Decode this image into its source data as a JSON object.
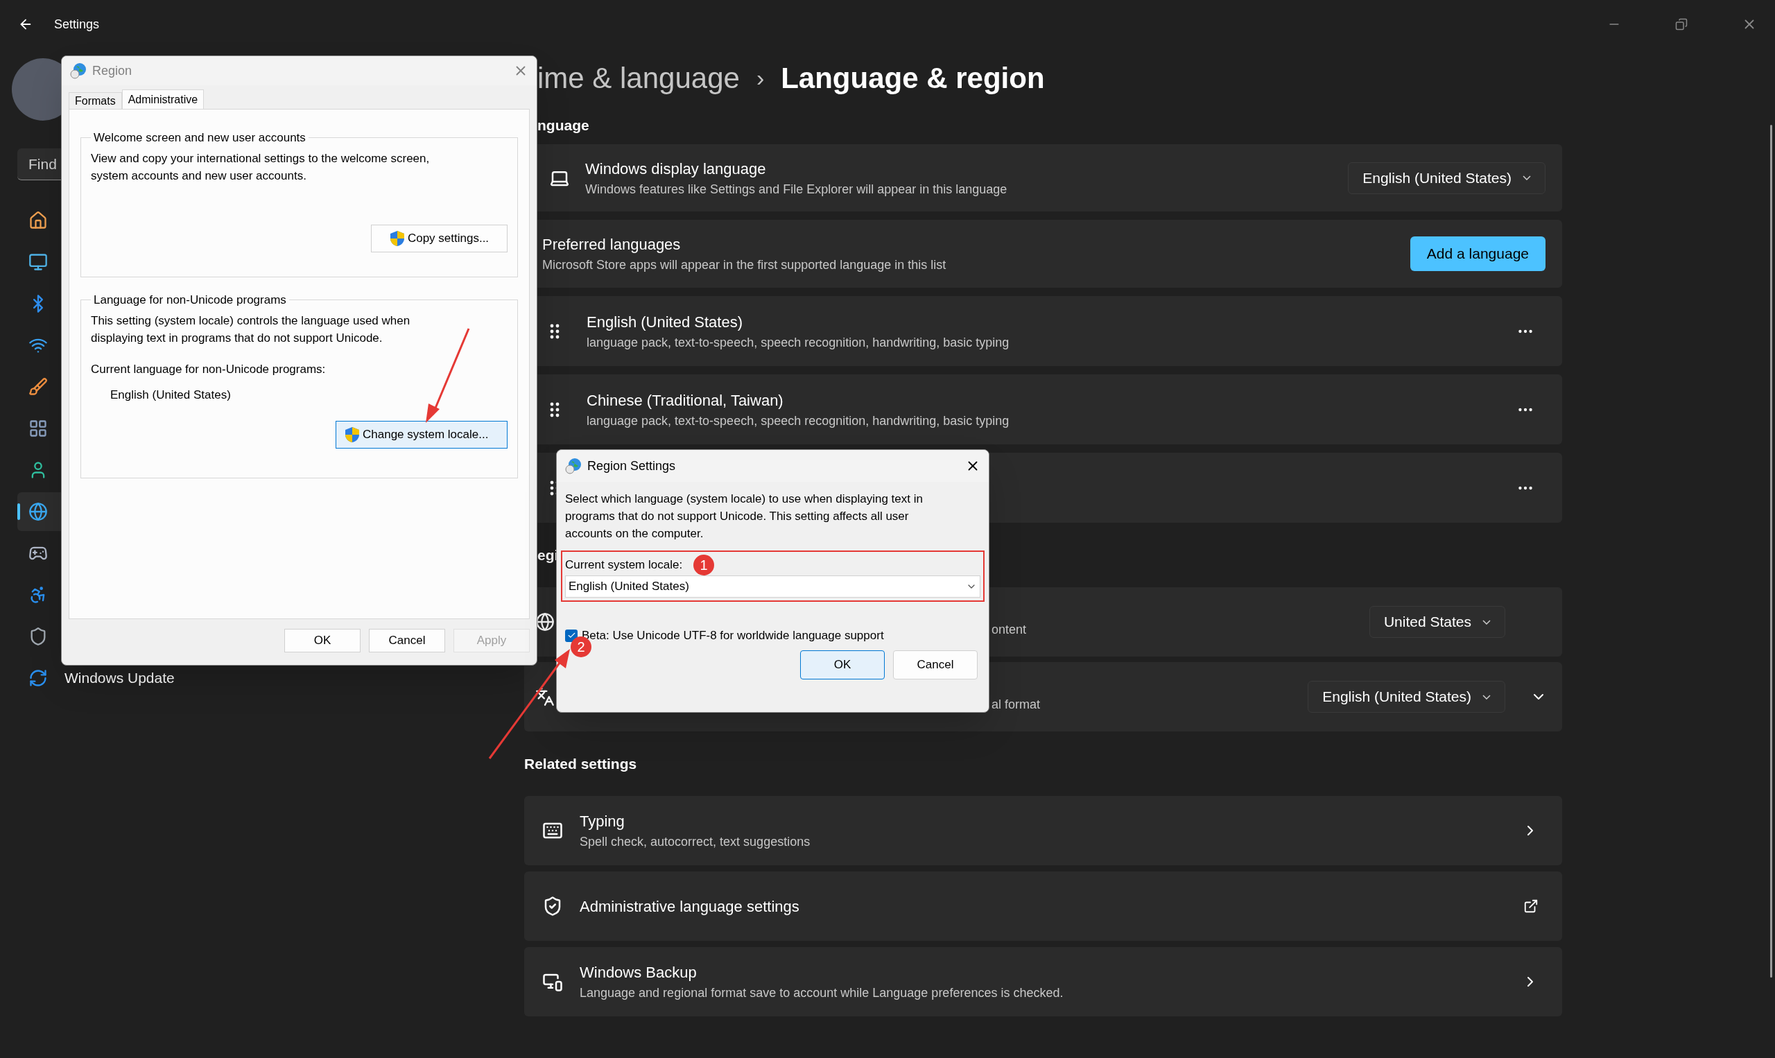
{
  "window": {
    "title": "Settings"
  },
  "sidebar": {
    "search": {
      "placeholder": "Find"
    },
    "nav_items": [
      {
        "selected": false
      },
      {
        "selected": false
      },
      {
        "selected": false
      },
      {
        "selected": false
      },
      {
        "selected": false
      },
      {
        "selected": false
      },
      {
        "selected": false
      },
      {
        "selected": true
      },
      {
        "selected": false
      },
      {
        "selected": false
      },
      {
        "selected": false
      },
      {
        "selected": false,
        "label": "Windows Update"
      }
    ]
  },
  "page": {
    "breadcrumb_parent": "ime & language",
    "separator": "›",
    "title": "Language & region"
  },
  "language_section": {
    "heading": "nguage",
    "display_language": {
      "title": "Windows display language",
      "description": "Windows features like Settings and File Explorer will appear in this language",
      "value": "English (United States)"
    },
    "preferred": {
      "title": "Preferred languages",
      "description": "Microsoft Store apps will appear in the first supported language in this list",
      "button": "Add a language"
    },
    "languages": [
      {
        "kind": "language",
        "name": "English (United States)",
        "features": "language pack, text-to-speech, speech recognition, handwriting, basic typing"
      },
      {
        "kind": "language",
        "name": "Chinese (Traditional, Taiwan)",
        "features": "language pack, text-to-speech, speech recognition, handwriting, basic typing"
      },
      {
        "kind": "covered"
      }
    ]
  },
  "region_section": {
    "heading": "egi",
    "rows": [
      {
        "text": "ontent",
        "value": "United States",
        "expandable": false
      },
      {
        "text": "al format",
        "value": "English (United States)",
        "expandable": true
      }
    ]
  },
  "related": {
    "heading": "Related settings",
    "items": [
      {
        "kind": "chevron",
        "title": "Typing",
        "description": "Spell check, autocorrect, text suggestions"
      },
      {
        "kind": "external",
        "title": "Administrative language settings"
      },
      {
        "kind": "chevron",
        "title": "Windows Backup",
        "description": "Language and regional format save to account while Language preferences is checked."
      }
    ]
  },
  "region_dialog": {
    "title": "Region",
    "tabs": [
      {
        "label": "Formats",
        "selected": false
      },
      {
        "label": "Administrative",
        "selected": true
      }
    ],
    "groups": [
      {
        "title": "Welcome screen and new user accounts",
        "text": "View and copy your international settings to the welcome screen, system accounts and new user accounts.",
        "button": "Copy settings...",
        "highlighted": false
      },
      {
        "title": "Language for non-Unicode programs",
        "text": "This setting (system locale) controls the language used when displaying text in programs that do not support Unicode.",
        "current_label": "Current language for non-Unicode programs:",
        "current_value": "English (United States)",
        "button": "Change system locale...",
        "highlighted": true
      }
    ],
    "buttons": [
      {
        "label": "OK",
        "disabled": false
      },
      {
        "label": "Cancel",
        "disabled": false
      },
      {
        "label": "Apply",
        "disabled": true
      }
    ]
  },
  "region_settings_dialog": {
    "title": "Region Settings",
    "text": "Select which language (system locale) to use when displaying text in programs that do not support Unicode. This setting affects all user accounts on the computer.",
    "locale_label": "Current system locale:",
    "locale_value": "English (United States)",
    "beta": {
      "label": "Beta: Use Unicode UTF-8 for worldwide language support",
      "checked": true
    },
    "buttons": [
      {
        "label": "OK",
        "default": true
      },
      {
        "label": "Cancel",
        "default": false
      }
    ]
  },
  "annotations": [
    {
      "number": "1"
    },
    {
      "number": "2"
    }
  ]
}
